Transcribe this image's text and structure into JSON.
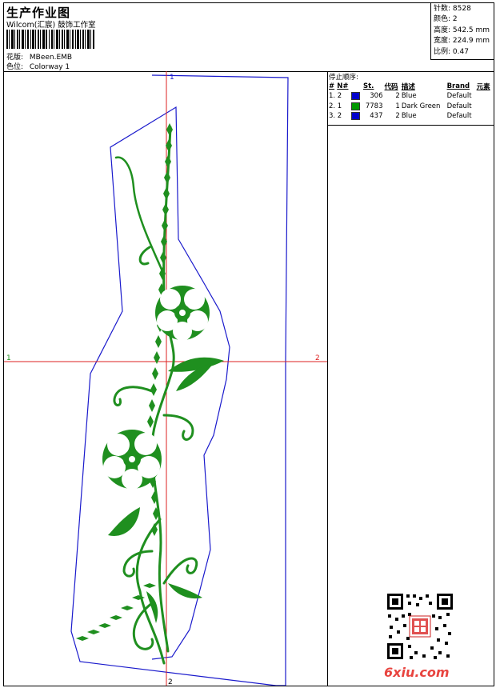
{
  "header": {
    "title": "生产作业图",
    "company": "Wilcom(汇宸) 鼓饰工作室",
    "design_label": "花版:",
    "design_value": "MBeen.EMB",
    "colorway_label": "色位:",
    "colorway_value": "Colorway 1"
  },
  "stats": {
    "stitches": "针数: 8528",
    "colors": "颜色: 2",
    "height": "高度: 542.5 mm",
    "width": "宽度: 224.9 mm",
    "scale": "比例: 0.47"
  },
  "crosshair_labels": {
    "top": "1",
    "bottom": "2",
    "left": "1",
    "right": "2"
  },
  "stop_sequence": {
    "title": "停止顺序:",
    "columns": [
      "#",
      "N#",
      "",
      "St.",
      "代码",
      "描述",
      "Brand",
      "元素"
    ],
    "rows": [
      {
        "index": "1. 2",
        "swatch": "#0000cc",
        "stitches": "306",
        "code": "2",
        "desc": "Blue",
        "brand": "Default"
      },
      {
        "index": "2. 1",
        "swatch": "#009900",
        "stitches": "7783",
        "code": "1",
        "desc": "Dark Green",
        "brand": "Default"
      },
      {
        "index": "3. 2",
        "swatch": "#0000cc",
        "stitches": "437",
        "code": "2",
        "desc": "Blue",
        "brand": "Default"
      }
    ]
  },
  "watermark": "6xiu.com",
  "colors": {
    "outline": "#1a1acc",
    "embroidery": "#1f8f1f",
    "crosshair": "#dd2222"
  }
}
